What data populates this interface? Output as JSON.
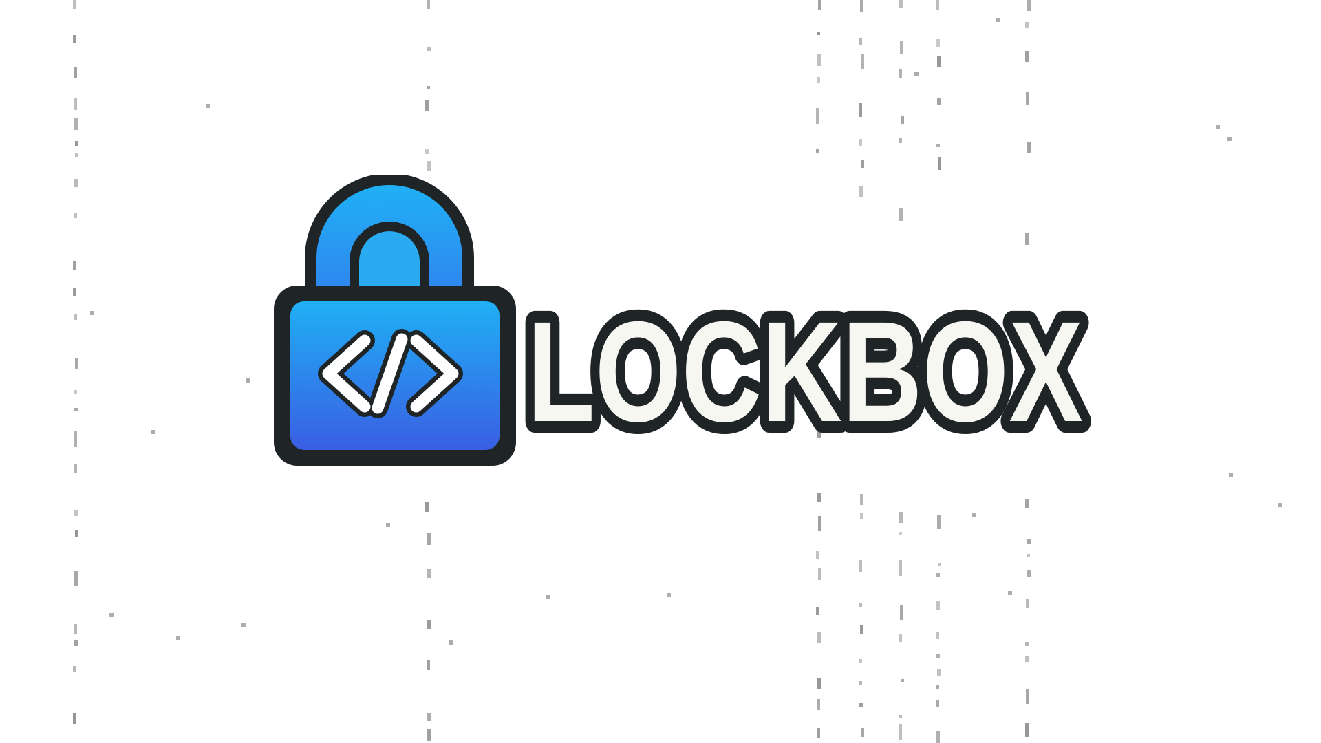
{
  "brand": {
    "name": "LOCKBOX",
    "icon": "padlock-code-icon",
    "icon_glyph": "</>"
  },
  "colors": {
    "background": "#ffffff",
    "outline": "#1f2426",
    "lock_body_top": "#1fb0f5",
    "lock_body_bottom": "#3a5ee3",
    "shackle_top": "#1fb0f5",
    "shackle_bottom": "#2f86ee",
    "wordmark_fill": "#f7f7f2",
    "wordmark_stroke": "#1f2426",
    "artifact_lines": "#8a8a8a"
  }
}
